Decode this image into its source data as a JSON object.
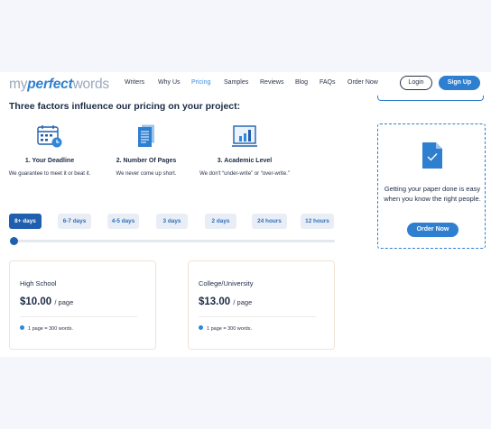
{
  "header": {
    "logo_part1": "my",
    "logo_part2": "perfect",
    "logo_part3": "words",
    "nav": [
      "Writers",
      "Why Us",
      "Pricing",
      "Samples",
      "Reviews",
      "Blog",
      "FAQs",
      "Order Now"
    ],
    "active_nav": "Pricing",
    "login_label": "Login",
    "signup_label": "Sign Up"
  },
  "section_title": "Three factors influence our pricing on your project:",
  "factors": [
    {
      "icon": "calendar-clock-icon",
      "title": "1. Your Deadline",
      "desc": "We guarantee to meet it or beat it."
    },
    {
      "icon": "pages-icon",
      "title": "2. Number Of Pages",
      "desc": "We never come up short."
    },
    {
      "icon": "bar-chart-icon",
      "title": "3. Academic Level",
      "desc": "We don't “under-write” or “over-write.”"
    }
  ],
  "deadlines": [
    "8+ days",
    "6-7 days",
    "4-5 days",
    "3 days",
    "2 days",
    "24 hours",
    "12 hours"
  ],
  "selected_deadline": "8+ days",
  "slider_fraction": 0,
  "cards": [
    {
      "level": "High School",
      "price": "$10.00",
      "per": "/ page",
      "note": "1 page = 300 words."
    },
    {
      "level": "College/University",
      "price": "$13.00",
      "per": "/ page",
      "note": "1 page = 300 words."
    }
  ],
  "promo": {
    "icon": "document-check-icon",
    "text": "Getting your paper done is easy when you know the right people.",
    "button_label": "Order Now"
  },
  "colors": {
    "brand_blue": "#2f7fd0",
    "active_tab": "#1f5fae",
    "page_background": "#f4f6fc"
  }
}
